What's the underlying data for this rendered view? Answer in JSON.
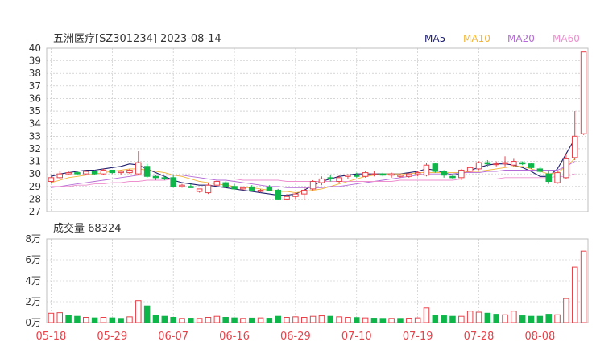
{
  "header": {
    "title": "五洲医疗[SZ301234] 2023-08-14"
  },
  "legend": [
    {
      "label": "MA5",
      "color": "#1f1f6e"
    },
    {
      "label": "MA10",
      "color": "#f2b53a"
    },
    {
      "label": "MA20",
      "color": "#b56bd6"
    },
    {
      "label": "MA60",
      "color": "#ee8fce"
    }
  ],
  "volume_panel": {
    "label": "成交量 68324"
  },
  "colors": {
    "up": "#e8424a",
    "down": "#0eb64a",
    "grid": "#bfbfbf",
    "axis": "#333333"
  },
  "chart_data": [
    {
      "type": "candlestick",
      "title": "五洲医疗[SZ301234] 2023-08-14",
      "ylim": [
        27,
        40
      ],
      "y_ticks": [
        "40",
        "39",
        "38",
        "37",
        "36",
        "35",
        "34",
        "33",
        "32",
        "31",
        "30",
        "29",
        "28",
        "27"
      ],
      "x_tick_labels": [
        "05-18",
        "05-29",
        "06-07",
        "06-16",
        "06-29",
        "07-10",
        "07-19",
        "07-28",
        "08-08"
      ],
      "x_tick_index": [
        0,
        7,
        14,
        21,
        28,
        35,
        42,
        49,
        56
      ],
      "grid": true,
      "legend_position": "top-right",
      "series": [
        {
          "name": "MA5",
          "values": [
            29.8,
            30.0,
            30.1,
            30.2,
            30.3,
            30.3,
            30.4,
            30.5,
            30.6,
            30.8,
            30.7,
            30.4,
            30.1,
            29.8,
            29.5,
            29.3,
            29.2,
            29.1,
            29.1,
            29.0,
            28.9,
            28.8,
            28.7,
            28.6,
            28.5,
            28.4,
            28.3,
            28.3,
            28.4,
            28.7,
            29.1,
            29.4,
            29.6,
            29.8,
            29.9,
            30.0,
            30.0,
            30.0,
            30.0,
            30.0,
            30.0,
            30.1,
            30.2,
            30.4,
            30.3,
            30.1,
            29.9,
            30.0,
            30.3,
            30.5,
            30.7,
            30.8,
            30.8,
            30.7,
            30.5,
            30.2,
            29.8,
            29.8,
            30.4,
            31.6,
            32.8
          ]
        },
        {
          "name": "MA10",
          "values": [
            29.3,
            29.5,
            29.7,
            29.8,
            29.9,
            30.0,
            30.1,
            30.2,
            30.3,
            30.4,
            30.4,
            30.3,
            30.2,
            30.1,
            29.9,
            29.8,
            29.6,
            29.4,
            29.3,
            29.2,
            29.1,
            29.0,
            28.9,
            28.9,
            28.8,
            28.7,
            28.6,
            28.6,
            28.5,
            28.6,
            28.7,
            28.8,
            29.0,
            29.2,
            29.4,
            29.6,
            29.8,
            29.9,
            30.0,
            30.0,
            30.0,
            30.0,
            30.1,
            30.1,
            30.1,
            30.1,
            30.1,
            30.1,
            30.2,
            30.2,
            30.3,
            30.4,
            30.5,
            30.6,
            30.6,
            30.4,
            30.2,
            30.0,
            30.1,
            30.6,
            31.2
          ]
        },
        {
          "name": "MA20",
          "values": [
            28.9,
            29.0,
            29.1,
            29.2,
            29.3,
            29.4,
            29.5,
            29.6,
            29.7,
            29.8,
            29.9,
            29.9,
            29.9,
            29.9,
            29.9,
            29.9,
            29.8,
            29.7,
            29.6,
            29.5,
            29.5,
            29.4,
            29.3,
            29.2,
            29.1,
            29.0,
            29.0,
            28.9,
            28.9,
            28.9,
            28.9,
            28.9,
            29.0,
            29.0,
            29.1,
            29.2,
            29.3,
            29.4,
            29.5,
            29.6,
            29.7,
            29.8,
            29.9,
            30.0,
            30.0,
            30.0,
            30.0,
            30.1,
            30.1,
            30.1,
            30.2,
            30.2,
            30.3,
            30.3,
            30.3,
            30.3,
            30.3,
            30.3,
            30.3,
            30.6,
            31.0
          ]
        },
        {
          "name": "MA60",
          "values": [
            29.0,
            29.0,
            29.0,
            29.1,
            29.1,
            29.2,
            29.2,
            29.3,
            29.3,
            29.4,
            29.4,
            29.5,
            29.5,
            29.5,
            29.6,
            29.6,
            29.6,
            29.6,
            29.6,
            29.6,
            29.6,
            29.6,
            29.5,
            29.5,
            29.5,
            29.5,
            29.5,
            29.4,
            29.4,
            29.4,
            29.4,
            29.4,
            29.4,
            29.4,
            29.4,
            29.4,
            29.4,
            29.4,
            29.4,
            29.4,
            29.5,
            29.5,
            29.5,
            29.5,
            29.5,
            29.5,
            29.5,
            29.6,
            29.6,
            29.6,
            29.6,
            29.6,
            29.7,
            29.7,
            29.7,
            29.7,
            29.7,
            29.7,
            29.8,
            29.8,
            30.0
          ]
        }
      ],
      "ohlc": [
        [
          29.4,
          29.9,
          29.3,
          29.7
        ],
        [
          29.7,
          30.2,
          29.6,
          30.0
        ],
        [
          30.0,
          30.2,
          29.9,
          30.1
        ],
        [
          30.1,
          30.2,
          29.9,
          30.0
        ],
        [
          30.0,
          30.3,
          29.9,
          30.2
        ],
        [
          30.2,
          30.3,
          29.9,
          30.0
        ],
        [
          30.0,
          30.4,
          29.9,
          30.3
        ],
        [
          30.3,
          30.3,
          30.0,
          30.1
        ],
        [
          30.1,
          30.3,
          29.9,
          30.2
        ],
        [
          30.1,
          30.4,
          30.0,
          30.3
        ],
        [
          30.0,
          31.8,
          29.9,
          30.9
        ],
        [
          30.6,
          30.8,
          29.7,
          29.8
        ],
        [
          29.8,
          29.9,
          29.5,
          29.7
        ],
        [
          29.7,
          29.8,
          29.5,
          29.6
        ],
        [
          29.7,
          29.9,
          28.9,
          29.0
        ],
        [
          29.0,
          29.2,
          28.9,
          29.1
        ],
        [
          29.0,
          29.2,
          28.9,
          28.9
        ],
        [
          28.6,
          28.8,
          28.5,
          28.8
        ],
        [
          28.5,
          29.3,
          28.4,
          29.1
        ],
        [
          29.1,
          29.5,
          29.0,
          29.4
        ],
        [
          29.3,
          29.4,
          28.9,
          29.0
        ],
        [
          29.0,
          29.2,
          28.8,
          28.8
        ],
        [
          28.8,
          29.0,
          28.7,
          28.9
        ],
        [
          28.9,
          29.1,
          28.7,
          28.7
        ],
        [
          28.6,
          28.8,
          28.5,
          28.7
        ],
        [
          28.9,
          29.1,
          28.6,
          28.7
        ],
        [
          28.7,
          28.8,
          27.9,
          28.0
        ],
        [
          28.0,
          28.4,
          27.9,
          28.2
        ],
        [
          28.2,
          28.5,
          28.0,
          28.4
        ],
        [
          28.4,
          28.9,
          27.9,
          28.7
        ],
        [
          28.8,
          29.5,
          28.7,
          29.4
        ],
        [
          29.3,
          29.8,
          29.1,
          29.6
        ],
        [
          29.7,
          29.9,
          29.4,
          29.6
        ],
        [
          29.4,
          29.9,
          29.3,
          29.7
        ],
        [
          29.8,
          30.0,
          29.6,
          29.9
        ],
        [
          29.9,
          30.1,
          29.7,
          29.8
        ],
        [
          29.8,
          30.2,
          29.7,
          30.1
        ],
        [
          30.0,
          30.2,
          29.8,
          30.0
        ],
        [
          30.0,
          30.1,
          29.8,
          29.9
        ],
        [
          29.9,
          30.1,
          29.7,
          30.0
        ],
        [
          29.8,
          30.0,
          29.7,
          29.9
        ],
        [
          29.8,
          30.1,
          29.7,
          30.0
        ],
        [
          30.0,
          30.2,
          29.8,
          30.1
        ],
        [
          29.9,
          30.9,
          29.8,
          30.7
        ],
        [
          30.8,
          30.9,
          30.1,
          30.2
        ],
        [
          30.2,
          30.3,
          29.7,
          29.9
        ],
        [
          29.8,
          30.0,
          29.6,
          29.7
        ],
        [
          29.7,
          30.4,
          29.5,
          30.3
        ],
        [
          30.2,
          30.6,
          30.1,
          30.5
        ],
        [
          30.4,
          31.0,
          30.3,
          30.9
        ],
        [
          30.9,
          31.1,
          30.6,
          30.8
        ],
        [
          30.8,
          31.0,
          30.6,
          30.8
        ],
        [
          30.8,
          31.4,
          30.6,
          30.9
        ],
        [
          30.7,
          31.2,
          30.6,
          31.0
        ],
        [
          30.9,
          31.0,
          30.7,
          30.8
        ],
        [
          30.8,
          30.9,
          30.4,
          30.5
        ],
        [
          30.4,
          30.6,
          30.1,
          30.2
        ],
        [
          30.0,
          30.3,
          29.2,
          29.4
        ],
        [
          29.3,
          30.2,
          29.2,
          30.1
        ],
        [
          29.7,
          31.6,
          29.6,
          31.2
        ],
        [
          31.3,
          35.0,
          31.1,
          33.0
        ],
        [
          33.2,
          39.7,
          33.1,
          39.7
        ]
      ]
    },
    {
      "type": "bar",
      "title": "成交量 68324",
      "ylim": [
        0,
        80000
      ],
      "y_tick_labels": [
        "8万",
        "6万",
        "4万",
        "2万",
        "0万"
      ],
      "values": [
        9000,
        9500,
        7000,
        6000,
        5000,
        4500,
        5000,
        4500,
        4000,
        5500,
        21000,
        16000,
        7000,
        6000,
        5000,
        4000,
        4200,
        4000,
        5000,
        6000,
        5000,
        4500,
        4000,
        4300,
        4500,
        4200,
        6000,
        5000,
        5500,
        5000,
        6000,
        6500,
        6000,
        5500,
        5000,
        4800,
        4500,
        4200,
        4000,
        4000,
        4000,
        4200,
        4500,
        14000,
        7000,
        6500,
        6000,
        6000,
        11000,
        10000,
        9000,
        8000,
        7500,
        11000,
        6500,
        6000,
        6000,
        8000,
        7500,
        23000,
        53000,
        68324
      ],
      "up": [
        1,
        1,
        0,
        0,
        1,
        0,
        1,
        0,
        0,
        1,
        1,
        0,
        0,
        0,
        0,
        1,
        0,
        1,
        1,
        1,
        0,
        0,
        1,
        0,
        1,
        0,
        0,
        1,
        1,
        1,
        1,
        1,
        0,
        1,
        1,
        0,
        1,
        0,
        0,
        1,
        0,
        1,
        1,
        1,
        0,
        0,
        0,
        1,
        1,
        1,
        0,
        0,
        1,
        1,
        0,
        0,
        0,
        0,
        1,
        1,
        1,
        1
      ]
    }
  ]
}
